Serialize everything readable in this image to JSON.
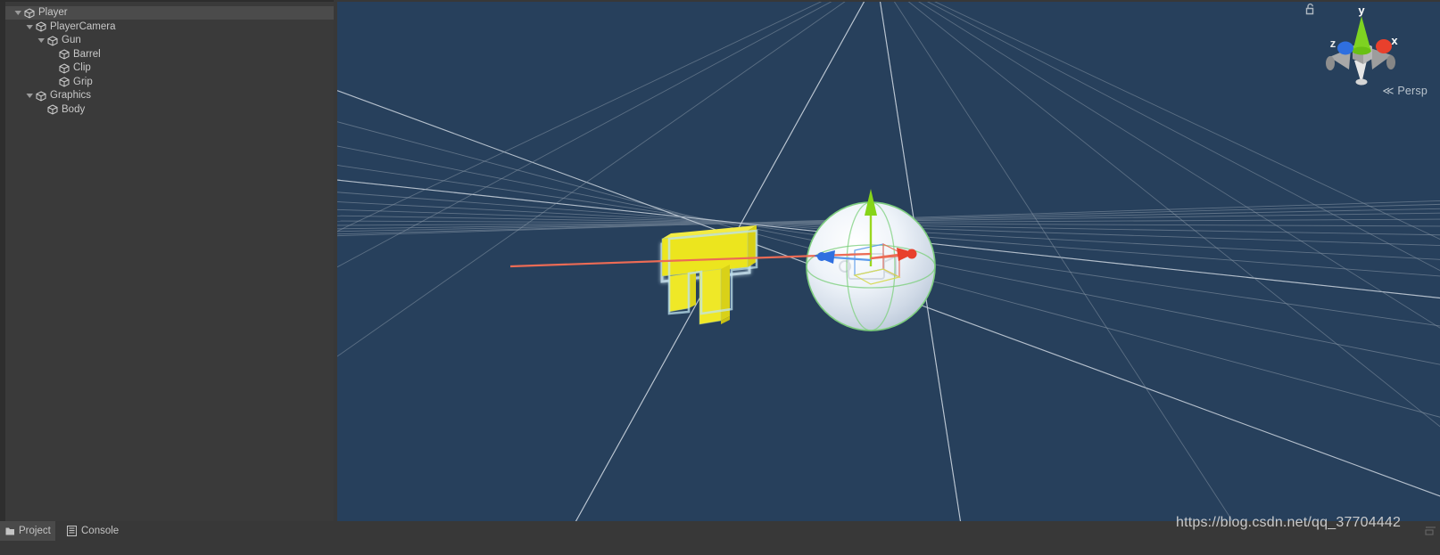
{
  "app": {
    "editor": "Unity Editor",
    "watermark": "https://blog.csdn.net/qq_37704442"
  },
  "hierarchy": {
    "panel_background": "#3a3a3a",
    "selected_row_background": "#4b4b4b",
    "text_color": "#c8c8c8",
    "items": [
      {
        "label": "Player",
        "depth": 0,
        "expanded": true,
        "has_children": true,
        "selected": true,
        "icon": "gameobject-cube-icon"
      },
      {
        "label": "PlayerCamera",
        "depth": 1,
        "expanded": true,
        "has_children": true,
        "selected": false,
        "icon": "gameobject-cube-icon"
      },
      {
        "label": "Gun",
        "depth": 2,
        "expanded": true,
        "has_children": true,
        "selected": false,
        "icon": "gameobject-cube-icon"
      },
      {
        "label": "Barrel",
        "depth": 3,
        "expanded": false,
        "has_children": false,
        "selected": false,
        "icon": "gameobject-cube-icon"
      },
      {
        "label": "Clip",
        "depth": 3,
        "expanded": false,
        "has_children": false,
        "selected": false,
        "icon": "gameobject-cube-icon"
      },
      {
        "label": "Grip",
        "depth": 3,
        "expanded": false,
        "has_children": false,
        "selected": false,
        "icon": "gameobject-cube-icon"
      },
      {
        "label": "Graphics",
        "depth": 1,
        "expanded": true,
        "has_children": true,
        "selected": false,
        "icon": "gameobject-cube-icon"
      },
      {
        "label": "Body",
        "depth": 2,
        "expanded": false,
        "has_children": false,
        "selected": false,
        "icon": "gameobject-cube-icon"
      }
    ]
  },
  "scene": {
    "background_color": "#27405c",
    "grid_color": "#9aa6b4",
    "objects": [
      {
        "name": "gun-mesh",
        "label": "Gun",
        "color": "#ece51e",
        "outline_color": "#bfe3ef",
        "selected": true
      },
      {
        "name": "sphere-mesh",
        "label": "Body",
        "color": "#f2f6fb",
        "outline_color": "#7ed07e",
        "selected": true
      }
    ],
    "gizmo": {
      "axis_x_label": "x",
      "axis_y_label": "y",
      "axis_z_label": "z",
      "axis_x_color": "#e8402c",
      "axis_y_color": "#7ed321",
      "axis_z_color": "#2f6fe0",
      "projection_label": "Persp",
      "projection_prefix": "≪",
      "lock_icon": "padlock-unlocked-icon"
    },
    "transform_gizmo": {
      "mode": "translate",
      "x_color": "#e8604c",
      "y_color": "#9ad71f",
      "z_color": "#4a8ee8"
    }
  },
  "bottom_bar": {
    "tabs": [
      {
        "label": "Project",
        "active": true,
        "icon": "folder-icon"
      },
      {
        "label": "Console",
        "active": false,
        "icon": "list-lines-icon"
      }
    ],
    "resize_grip": "resize-grip-icon"
  }
}
